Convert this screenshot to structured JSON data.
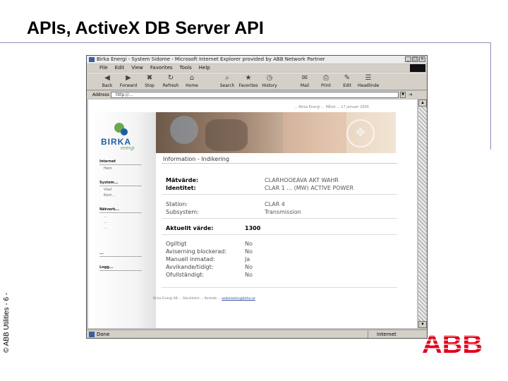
{
  "slide": {
    "title": "APIs, ActiveX DB Server API",
    "side_text": "© ABB Utilities - 6 -",
    "logo_text": "ABB"
  },
  "browser": {
    "window_title": "Birka Energi - System Sidome - Microsoft Internet Explorer provided by ABB Network Partner",
    "menu": [
      "File",
      "Edit",
      "View",
      "Favorites",
      "Tools",
      "Help"
    ],
    "toolbar": [
      {
        "label": "Back",
        "icon": "back-arrow-icon"
      },
      {
        "label": "Forward",
        "icon": "forward-arrow-icon"
      },
      {
        "label": "Stop",
        "icon": "stop-icon"
      },
      {
        "label": "Refresh",
        "icon": "refresh-icon"
      },
      {
        "label": "Home",
        "icon": "home-icon"
      },
      {
        "label": "Search",
        "icon": "search-icon"
      },
      {
        "label": "Favorites",
        "icon": "favorites-icon"
      },
      {
        "label": "History",
        "icon": "history-icon"
      },
      {
        "label": "Mail",
        "icon": "mail-icon"
      },
      {
        "label": "Print",
        "icon": "print-icon"
      },
      {
        "label": "Edit",
        "icon": "edit-icon"
      },
      {
        "label": "Headlinde",
        "icon": "headline-icon"
      }
    ],
    "address_label": "Address",
    "address_value": "http://...",
    "status_left": "Done",
    "status_zone": "Internet"
  },
  "page": {
    "header_date": "... Birka Energi ... Månd ... 17 januari 2000",
    "brand_name": "BIRKA",
    "brand_sub": "energi",
    "nav_sections": [
      {
        "heading": "Internet",
        "items": [
          "Hem"
        ]
      },
      {
        "heading": "System...",
        "items": [
          "Vlad",
          "Kont..."
        ]
      },
      {
        "heading": "Nätverk...",
        "items": [
          "...",
          "...",
          "..."
        ]
      },
      {
        "heading": "...",
        "items": []
      },
      {
        "heading": "Logg...",
        "items": []
      }
    ],
    "content_heading": "Information - Indikering",
    "details": [
      {
        "label": "Mätvärde:",
        "value": "CLARHOOEAVA AKT WAHR",
        "bold": true
      },
      {
        "label": "Identitet:",
        "value": "CLAR 1 ... (MW) ACTIVE POWER",
        "bold": true
      },
      {
        "label": "Station:",
        "value": "CLAR 4",
        "bold": false
      },
      {
        "label": "Subsystem:",
        "value": "Transmission",
        "bold": false
      },
      {
        "label": "Aktuellt värde:",
        "value": "1300",
        "bold": true
      },
      {
        "label": "Ogiltigt",
        "value": "No",
        "bold": false
      },
      {
        "label": "Aviserning blockerad:",
        "value": "No",
        "bold": false
      },
      {
        "label": "Manuell inmatad:",
        "value": "Ja",
        "bold": false
      },
      {
        "label": "Avvikande/tidigt:",
        "value": "No",
        "bold": false
      },
      {
        "label": "Ofullständigt:",
        "value": "No",
        "bold": false
      }
    ],
    "footer_text": "Birka Energi AB ... Stockholm ... Kontakt ...",
    "footer_link": "webmaster@birka.se"
  },
  "colors": {
    "title_line": "#8a8fb8",
    "abb_red": "#e2001a",
    "birka_blue": "#1d5fa3",
    "birka_green": "#6aa84f",
    "ie_chrome": "#d4d0c8"
  }
}
